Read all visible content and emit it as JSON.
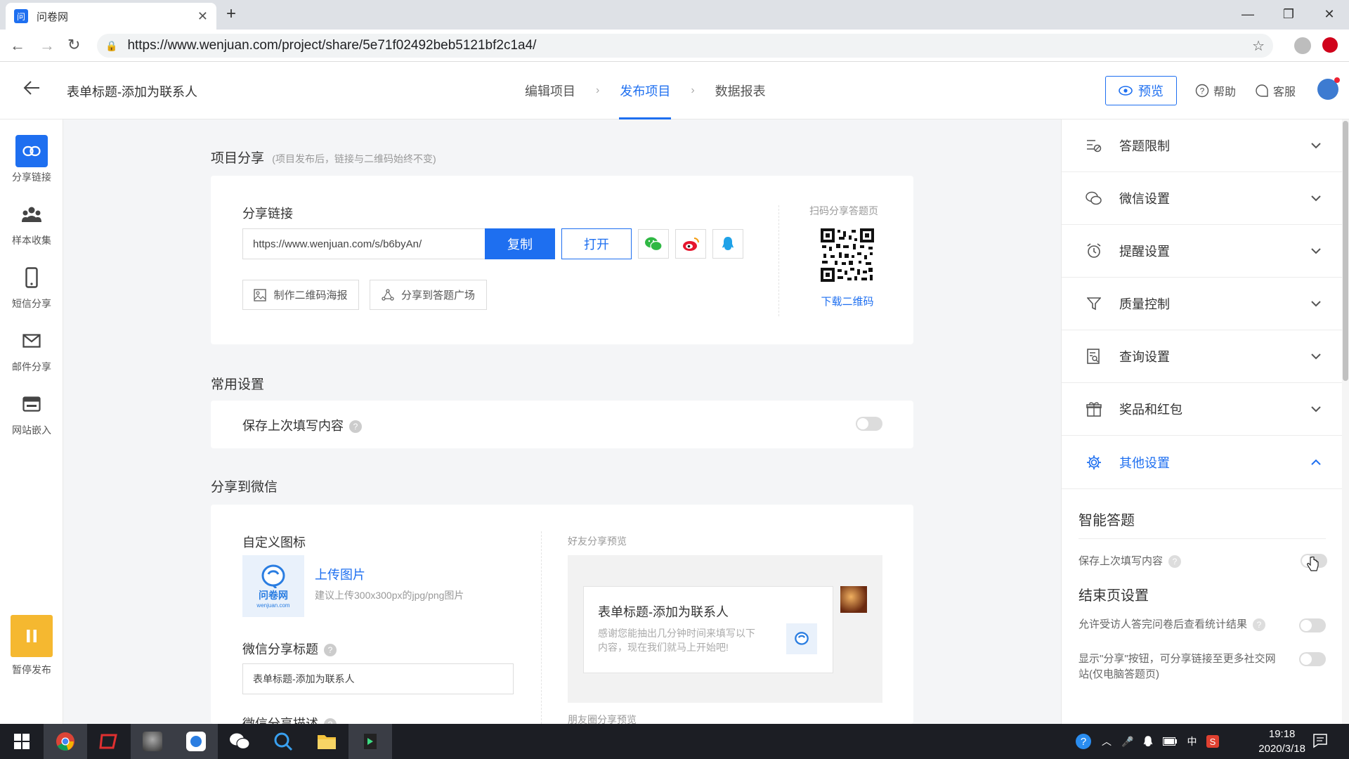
{
  "browser": {
    "tab_title": "问卷网",
    "favicon_text": "问",
    "url": "https://www.wenjuan.com/project/share/5e71f02492beb5121bf2c1a4/"
  },
  "header": {
    "title": "表单标题-添加为联系人",
    "steps": [
      "编辑项目",
      "发布项目",
      "数据报表"
    ],
    "active_step": "发布项目",
    "preview_label": "预览",
    "help_label": "帮助",
    "service_label": "客服"
  },
  "left_nav": {
    "items": [
      {
        "label": "分享链接",
        "icon": "link-icon",
        "active": true
      },
      {
        "label": "样本收集",
        "icon": "people-icon",
        "active": false
      },
      {
        "label": "短信分享",
        "icon": "phone-icon",
        "active": false
      },
      {
        "label": "邮件分享",
        "icon": "mail-icon",
        "active": false
      },
      {
        "label": "网站嵌入",
        "icon": "embed-icon",
        "active": false
      }
    ],
    "pause_label": "暂停发布"
  },
  "share": {
    "title": "项目分享",
    "hint": "(项目发布后，链接与二维码始终不变)",
    "link_label": "分享链接",
    "link_value": "https://www.wenjuan.com/s/b6byAn/",
    "copy_label": "复制",
    "open_label": "打开",
    "poster_label": "制作二维码海报",
    "square_label": "分享到答题广场",
    "qr_caption": "扫码分享答题页",
    "qr_download": "下载二维码"
  },
  "common": {
    "title": "常用设置",
    "save_last_label": "保存上次填写内容",
    "save_last_on": false
  },
  "wechat": {
    "title": "分享到微信",
    "custom_icon_label": "自定义图标",
    "logo_text": "问卷网",
    "logo_sub": "wenjuan.com",
    "upload_label": "上传图片",
    "upload_hint": "建议上传300x300px的jpg/png图片",
    "share_title_label": "微信分享标题",
    "share_title_value": "表单标题-添加为联系人",
    "share_desc_label": "微信分享描述",
    "friend_preview_label": "好友分享预览",
    "preview_title": "表单标题-添加为联系人",
    "preview_desc": "感谢您能抽出几分钟时间来填写以下内容，现在我们就马上开始吧!",
    "moments_preview_label": "朋友圈分享预览"
  },
  "right_panel": {
    "sections": [
      {
        "label": "答题限制",
        "icon": "limit-icon",
        "open": false
      },
      {
        "label": "微信设置",
        "icon": "wechat-icon",
        "open": false
      },
      {
        "label": "提醒设置",
        "icon": "alarm-icon",
        "open": false
      },
      {
        "label": "质量控制",
        "icon": "filter-icon",
        "open": false
      },
      {
        "label": "查询设置",
        "icon": "query-icon",
        "open": false
      },
      {
        "label": "奖品和红包",
        "icon": "gift-icon",
        "open": false
      },
      {
        "label": "其他设置",
        "icon": "gear-icon",
        "open": true
      }
    ],
    "smart_title": "智能答题",
    "smart_save_label": "保存上次填写内容",
    "end_title": "结束页设置",
    "end_stats_label": "允许受访人答完问卷后查看统计结果",
    "end_share_label": "显示\"分享\"按钮，可分享链接至更多社交网站(仅电脑答题页)"
  },
  "taskbar": {
    "time": "19:18",
    "date": "2020/3/18",
    "ime": "中"
  },
  "colors": {
    "accent": "#1e6ff0",
    "pause": "#f5b830"
  }
}
